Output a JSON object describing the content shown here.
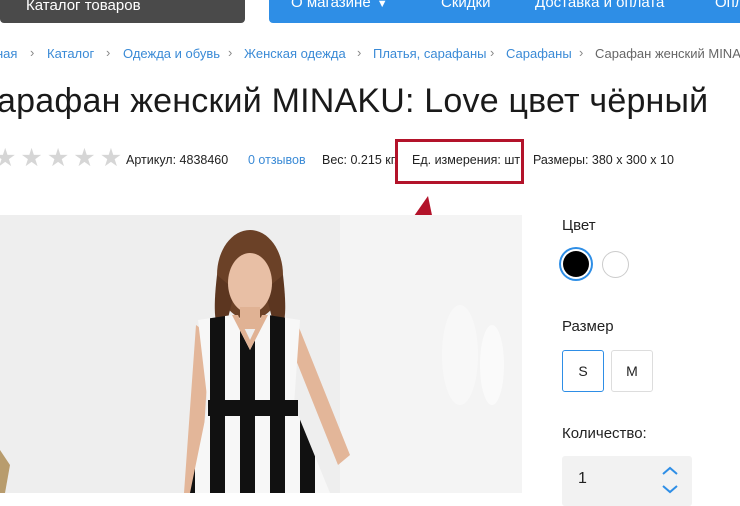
{
  "header": {
    "catalog_label": "Каталог товаров",
    "nav": [
      {
        "label": "О магазине",
        "has_dropdown": true
      },
      {
        "label": "Скидки"
      },
      {
        "label": "Доставка и оплата"
      },
      {
        "label": "Опл"
      }
    ]
  },
  "breadcrumb": [
    "ная",
    "Каталог",
    "Одежда и обувь",
    "Женская одежда",
    "Платья, сарафаны",
    "Сарафаны",
    "Сарафан женский MINAKU"
  ],
  "product": {
    "title": "арафан женский MINAKU: Love цвет чёрный",
    "rating_stars": 0,
    "rating_max": 5,
    "sku": "Артикул: 4838460",
    "reviews": "0 отзывов",
    "weight": "Вес: 0.215 кг.",
    "unit": "Ед. измерения: шт",
    "dimensions": "Размеры: 380 x 300 x 10"
  },
  "options": {
    "color_label": "Цвет",
    "colors": [
      {
        "name": "black",
        "hex": "#000000",
        "selected": true
      },
      {
        "name": "white",
        "hex": "#ffffff",
        "selected": false
      }
    ],
    "size_label": "Размер",
    "sizes": [
      {
        "label": "S",
        "selected": true
      },
      {
        "label": "M",
        "selected": false
      }
    ],
    "quantity_label": "Количество:",
    "quantity_value": "1"
  },
  "colors": {
    "accent": "#2e8ee6",
    "highlight": "#b3132a",
    "dark_button": "#4a4a4a"
  }
}
